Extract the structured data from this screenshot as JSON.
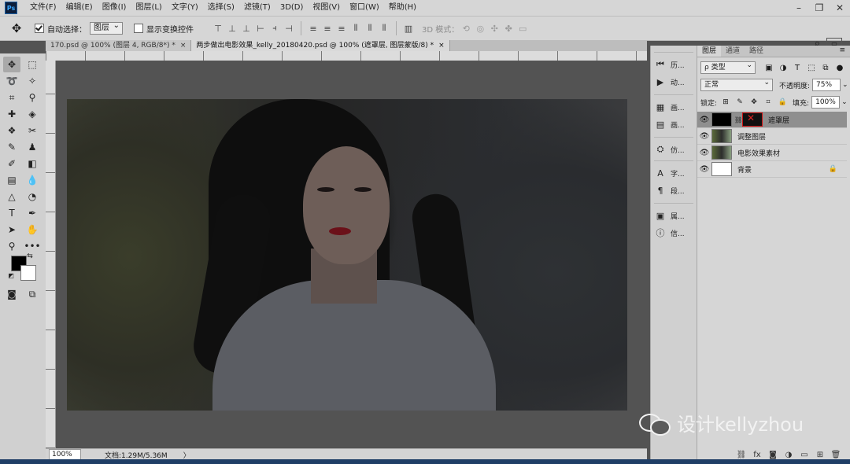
{
  "app": {
    "logo": "Ps"
  },
  "menu": [
    "文件(F)",
    "编辑(E)",
    "图像(I)",
    "图层(L)",
    "文字(Y)",
    "选择(S)",
    "滤镜(T)",
    "3D(D)",
    "视图(V)",
    "窗口(W)",
    "帮助(H)"
  ],
  "window_controls": [
    "–",
    "❐",
    "✕"
  ],
  "options": {
    "auto_select_label": "自动选择：",
    "auto_select_value": "图层",
    "show_transform_label": "显示变换控件",
    "mode3d_label": "3D 模式："
  },
  "tabs": [
    {
      "label": "170.psd @ 100% (图层 4, RGB/8*) *",
      "close": "×"
    },
    {
      "label": "两步做出电影效果_kelly_20180420.psd @ 100% (遮罩层, 图层蒙版/8) *",
      "close": "×"
    }
  ],
  "statusbar": {
    "zoom": "100%",
    "doc_info": "文档:1.29M/5.36M",
    "arrow": "〉"
  },
  "dock": {
    "groups": [
      [
        {
          "icon": "history-icon",
          "glyph": "⏮",
          "label": "历..."
        },
        {
          "icon": "play-icon",
          "glyph": "▶",
          "label": "动..."
        }
      ],
      [
        {
          "icon": "brush-panel-icon",
          "glyph": "▦",
          "label": "画..."
        },
        {
          "icon": "brush-preset-icon",
          "glyph": "▤",
          "label": "画..."
        }
      ],
      [
        {
          "icon": "clone-source-icon",
          "glyph": "⛭",
          "label": "仿..."
        }
      ],
      [
        {
          "icon": "character-icon",
          "glyph": "A",
          "label": "字..."
        },
        {
          "icon": "paragraph-icon",
          "glyph": "¶",
          "label": "段..."
        }
      ],
      [
        {
          "icon": "properties-icon",
          "glyph": "▣",
          "label": "属..."
        },
        {
          "icon": "info-icon",
          "glyph": "ⓘ",
          "label": "信..."
        }
      ]
    ]
  },
  "layers_panel": {
    "tabs": [
      "图层",
      "通道",
      "路径"
    ],
    "filter_label": "ρ 类型",
    "blend_mode": "正常",
    "opacity_label": "不透明度:",
    "opacity": "75%",
    "lock_label": "锁定:",
    "fill_label": "填充:",
    "fill": "100%",
    "layers": [
      {
        "name": "遮罩层",
        "thumb": "black",
        "mask": true,
        "selected": true,
        "locked": false
      },
      {
        "name": "调整图层",
        "thumb": "photo",
        "mask": false,
        "selected": false,
        "locked": false
      },
      {
        "name": "电影效果素材",
        "thumb": "photo",
        "mask": false,
        "selected": false,
        "locked": false
      },
      {
        "name": "背景",
        "thumb": "white",
        "mask": false,
        "selected": false,
        "locked": true
      }
    ]
  },
  "watermark": {
    "text": "设计kellyzhou"
  }
}
